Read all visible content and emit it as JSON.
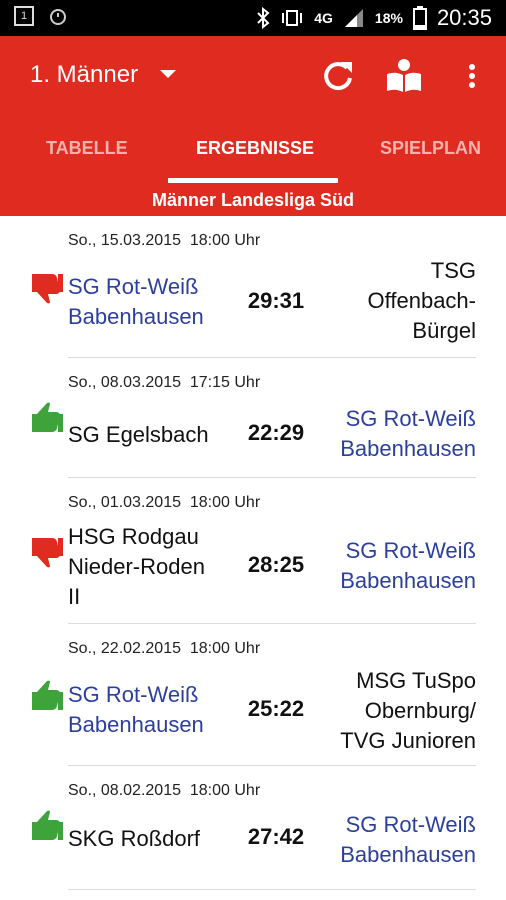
{
  "status_bar": {
    "battery": "18%",
    "network": "4G",
    "time": "20:35"
  },
  "header": {
    "team_selector": "1. Männer"
  },
  "tabs": [
    {
      "label": "TABELLE",
      "active": false
    },
    {
      "label": "ERGEBNISSE",
      "active": true
    },
    {
      "label": "SPIELPLAN",
      "active": false
    }
  ],
  "league": "Männer Landesliga Süd",
  "matches": [
    {
      "date": "So., 15.03.2015  18:00 Uhr",
      "home": "SG Rot-Weiß\nBabenhausen",
      "score": "29:31",
      "away": "TSG\nOffenbach-\nBürgel",
      "result": "loss"
    },
    {
      "date": "So., 08.03.2015  17:15 Uhr",
      "home": "SG Egelsbach",
      "score": "22:29",
      "away": "SG Rot-Weiß\nBabenhausen",
      "result": "win"
    },
    {
      "date": "So., 01.03.2015  18:00 Uhr",
      "home": "HSG Rodgau\nNieder-Roden\nII",
      "score": "28:25",
      "away": "SG Rot-Weiß\nBabenhausen",
      "result": "loss"
    },
    {
      "date": "So., 22.02.2015  18:00 Uhr",
      "home": "SG Rot-Weiß\nBabenhausen",
      "score": "25:22",
      "away": "MSG TuSpo\nObernburg/\nTVG Junioren",
      "result": "win"
    },
    {
      "date": "So., 08.02.2015  18:00 Uhr",
      "home": "SKG Roßdorf",
      "score": "27:42",
      "away": "SG Rot-Weiß\nBabenhausen",
      "result": "win"
    }
  ],
  "colors": {
    "primary": "#e02b20",
    "highlight_team": "#2c3f9e",
    "win": "#3ea33a",
    "loss": "#e02b20"
  }
}
